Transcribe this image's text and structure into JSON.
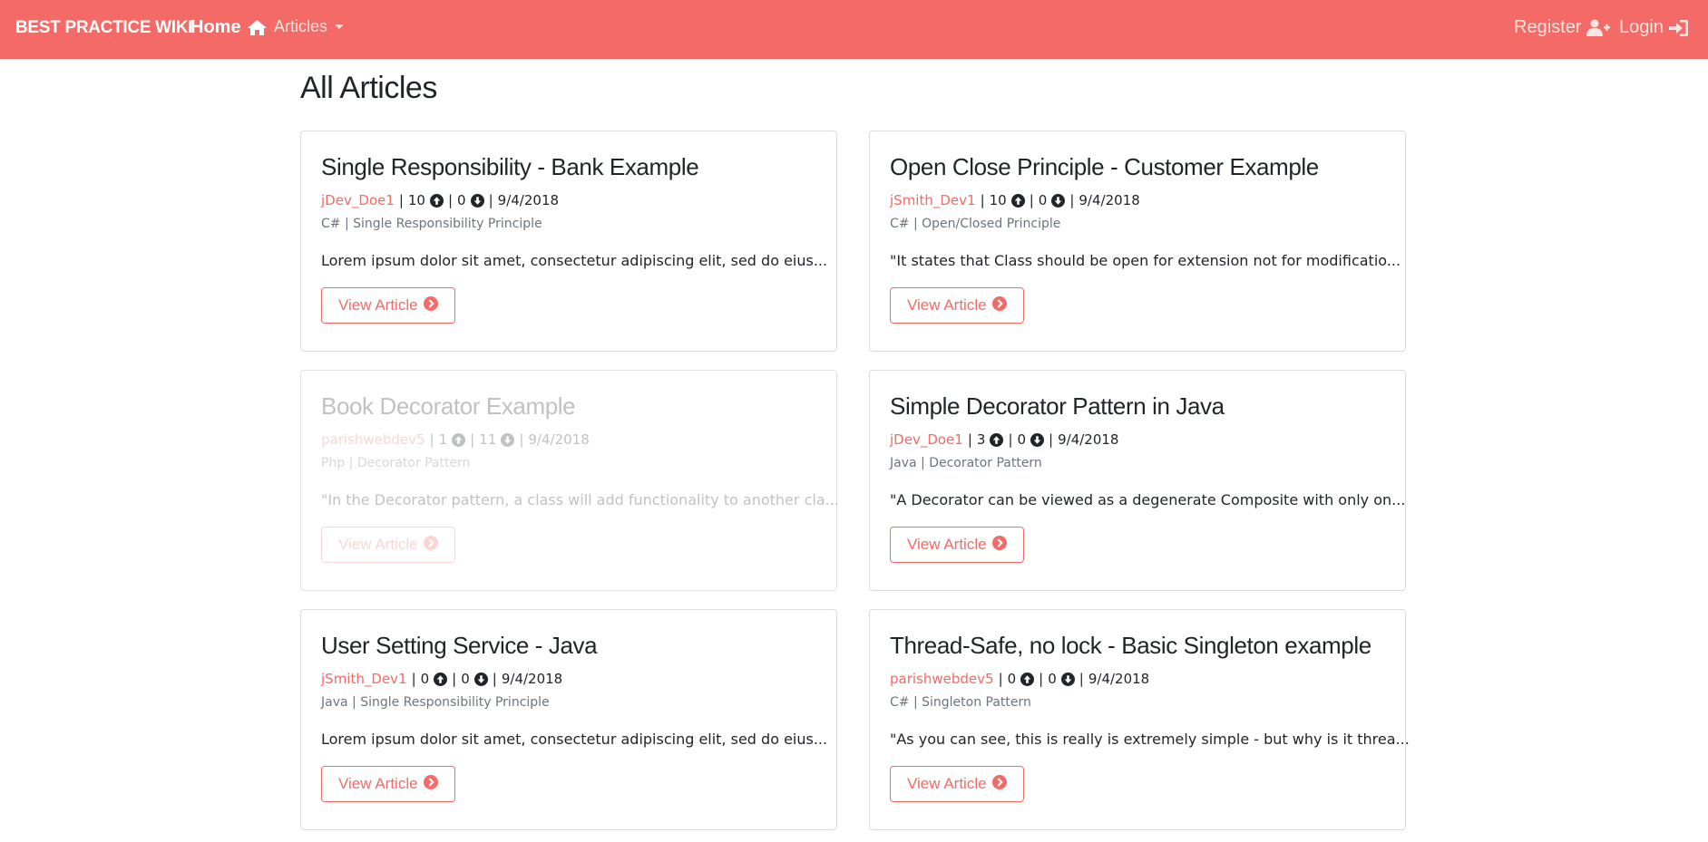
{
  "nav": {
    "brand": "BEST PRACTICE WIKI",
    "home": "Home",
    "articles": "Articles",
    "register": "Register",
    "login": "Login"
  },
  "page": {
    "title": "All Articles"
  },
  "colors": {
    "primary": "#f46a66",
    "text": "#212529",
    "muted": "#6c757d"
  },
  "articles": [
    {
      "title": "Single Responsibility - Bank Example",
      "author": "jDev_Doe1",
      "upvotes": "10",
      "downvotes": "0",
      "date": "9/4/2018",
      "category": "C# | Single Responsibility Principle",
      "excerpt": "Lorem ipsum dolor sit amet, consectetur adipiscing elit, sed do eius...",
      "button": "View Article"
    },
    {
      "title": "Open Close Principle - Customer Example",
      "author": "jSmith_Dev1",
      "upvotes": "10",
      "downvotes": "0",
      "date": "9/4/2018",
      "category": "C# | Open/Closed Principle",
      "excerpt": "\"It states that Class should be open for extension not for modificatio...",
      "button": "View Article"
    },
    {
      "title": "Book Decorator Example",
      "author": "parishwebdev5",
      "upvotes": "1",
      "downvotes": "11",
      "date": "9/4/2018",
      "category": "Php | Decorator Pattern",
      "excerpt": "\"In the Decorator pattern, a class will add functionality to another cla...",
      "button": "View Article"
    },
    {
      "title": "Simple Decorator Pattern in Java",
      "author": "jDev_Doe1",
      "upvotes": "3",
      "downvotes": "0",
      "date": "9/4/2018",
      "category": "Java | Decorator Pattern",
      "excerpt": "\"A Decorator can be viewed as a degenerate Composite with only on...",
      "button": "View Article"
    },
    {
      "title": "User Setting Service - Java",
      "author": "jSmith_Dev1",
      "upvotes": "0",
      "downvotes": "0",
      "date": "9/4/2018",
      "category": "Java | Single Responsibility Principle",
      "excerpt": "Lorem ipsum dolor sit amet, consectetur adipiscing elit, sed do eius...",
      "button": "View Article"
    },
    {
      "title": "Thread-Safe, no lock - Basic Singleton example",
      "author": "parishwebdev5",
      "upvotes": "0",
      "downvotes": "0",
      "date": "9/4/2018",
      "category": "C# | Singleton Pattern",
      "excerpt": "\"As you can see, this is really is extremely simple - but why is it threa...",
      "button": "View Article"
    }
  ]
}
